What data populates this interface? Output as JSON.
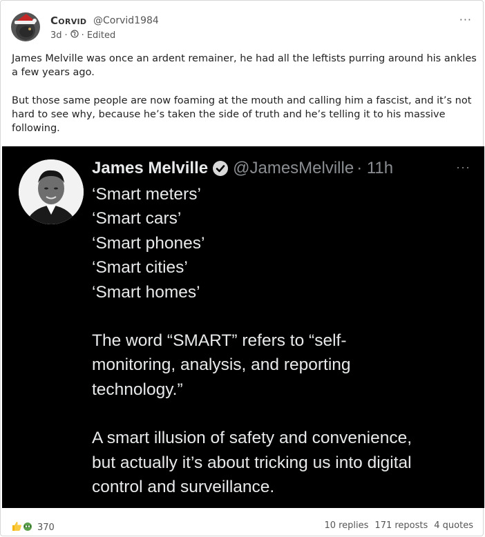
{
  "post": {
    "author_name": "Corvid",
    "author_handle": "@Corvid1984",
    "age": "3d",
    "edited": "Edited",
    "more": "···",
    "body": [
      "James Melville was once an ardent remainer, he had all the leftists purring around his ankles a few years ago.",
      "But those same people are now foaming at the mouth and calling him a fascist, and it’s not hard to see why, because he’s taken the side of truth and he’s telling it to his massive following."
    ]
  },
  "tweet": {
    "name": "James Melville",
    "handle": "@JamesMelville",
    "time": "· 11h",
    "more": "···",
    "lines": [
      "‘Smart meters’",
      "‘Smart cars’",
      "‘Smart phones’",
      "‘Smart cities’",
      "‘Smart homes’",
      "",
      "The word “SMART” refers to “self-",
      "monitoring, analysis, and reporting",
      "technology.”",
      "",
      "A smart illusion of safety and convenience,",
      "but actually it’s about tricking us into digital",
      "control and surveillance."
    ]
  },
  "footer": {
    "reaction_count": "370",
    "replies": "10 replies",
    "reposts": "171 reposts",
    "quotes": "4 quotes"
  }
}
